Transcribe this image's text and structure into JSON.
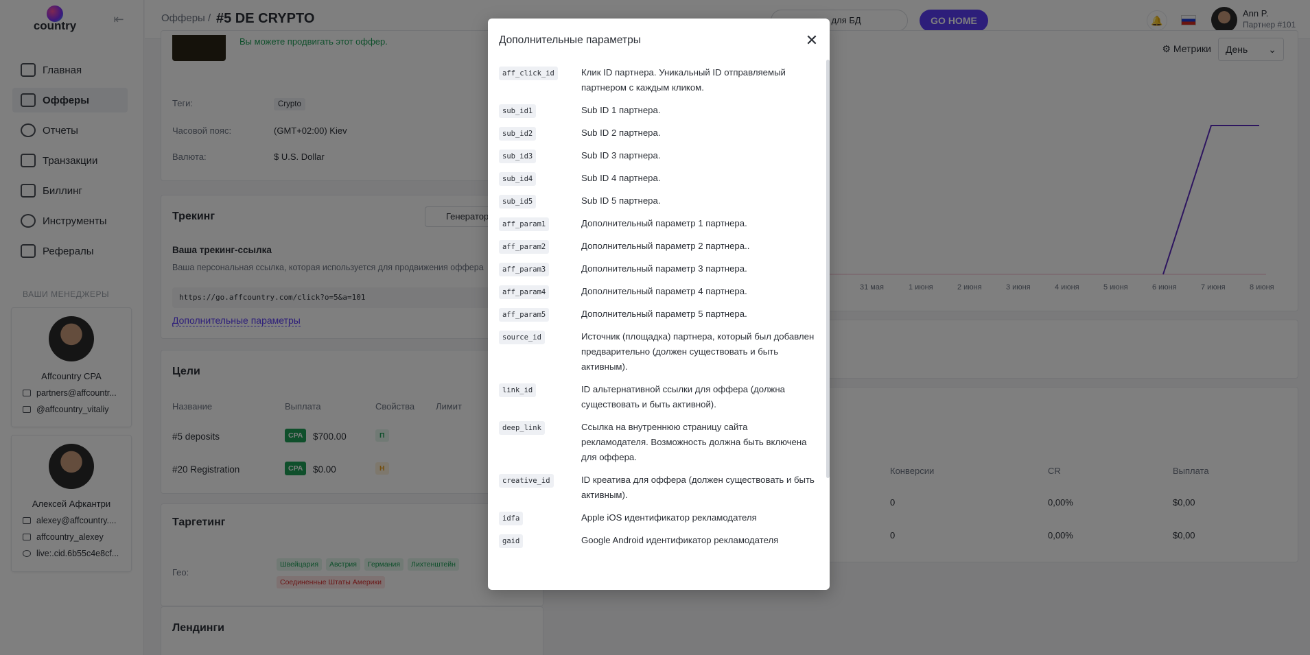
{
  "brand": {
    "logo_text": "country"
  },
  "sidebar": {
    "items": [
      {
        "label": "Главная",
        "icon": "dashboard-icon"
      },
      {
        "label": "Офферы",
        "icon": "offers-icon",
        "active": true
      },
      {
        "label": "Отчеты",
        "icon": "reports-icon"
      },
      {
        "label": "Транзакции",
        "icon": "transactions-icon"
      },
      {
        "label": "Биллинг",
        "icon": "billing-icon"
      },
      {
        "label": "Инструменты",
        "icon": "tools-icon"
      },
      {
        "label": "Рефералы",
        "icon": "referrals-icon"
      }
    ],
    "managers_title": "ВАШИ МЕНЕДЖЕРЫ",
    "managers": [
      {
        "name": "Affcountry CPA",
        "email": "partners@affcountr...",
        "telegram": "@affcountry_vitaliy"
      },
      {
        "name": "Алексей Афкантри",
        "email": "alexey@affcountry....",
        "telegram": "affcountry_alexey",
        "skype": "live:.cid.6b55c4e8cf..."
      }
    ]
  },
  "header": {
    "breadcrumb": "Офферы /",
    "title": "#5 DE CRYPTO",
    "search_text": "резюме для БД",
    "go_home_label": "GO HOME",
    "user_name": "Ann P.",
    "user_role": "Партнер #101"
  },
  "offer": {
    "promo_text": "Вы можете продвигать этот оффер.",
    "tags_label": "Теги:",
    "tags_value": "Crypto",
    "timezone_label": "Часовой пояс:",
    "timezone_value": "(GMT+02:00) Kiev",
    "currency_label": "Валюта:",
    "currency_value": "$ U.S. Dollar"
  },
  "tracking": {
    "title": "Трекинг",
    "generator_label": "Генератор",
    "link_title": "Ваша трекинг-ссылка",
    "link_hint": "Ваша персональная ссылка, которая используется для продвижения оффера",
    "link_value": "https://go.affcountry.com/click?o=5&a=101",
    "extra_params_link": "Дополнительные параметры"
  },
  "goals": {
    "title": "Цели",
    "columns": [
      "Название",
      "Выплата",
      "Свойства",
      "Лимит"
    ],
    "rows": [
      {
        "name": "#5  deposits",
        "type": "CPA",
        "payout": "$700.00",
        "prop": "П"
      },
      {
        "name": "#20  Registration",
        "type": "CPA",
        "payout": "$0.00",
        "prop": "Н"
      }
    ]
  },
  "targeting": {
    "title": "Таргетинг",
    "geo_label": "Гео:",
    "geos_allowed": [
      "Швейцария",
      "Австрия",
      "Германия",
      "Лихтенштейн"
    ],
    "geos_blocked": [
      "Соединенные Штаты Америки"
    ]
  },
  "landings": {
    "title": "Лендинги"
  },
  "chart": {
    "metrics_label": "Метрики",
    "period_label": "День",
    "x_labels": [
      "31 мая",
      "1 июня",
      "2 июня",
      "3 июня",
      "4 июня",
      "5 июня",
      "6 июня",
      "7 июня",
      "8 июня"
    ]
  },
  "stats_table": {
    "columns": [
      "Конверсии",
      "CR",
      "Выплата"
    ],
    "rows": [
      [
        "0",
        "0,00%",
        "$0,00"
      ],
      [
        "0",
        "0,00%",
        "$0,00"
      ]
    ]
  },
  "modal": {
    "title": "Дополнительные параметры",
    "params": [
      {
        "code": "aff_click_id",
        "desc": "Клик ID партнера. Уникальный ID отправляемый партнером с каждым кликом."
      },
      {
        "code": "sub_id1",
        "desc": "Sub ID 1 партнера."
      },
      {
        "code": "sub_id2",
        "desc": "Sub ID 2 партнера."
      },
      {
        "code": "sub_id3",
        "desc": "Sub ID 3 партнера."
      },
      {
        "code": "sub_id4",
        "desc": "Sub ID 4 партнера."
      },
      {
        "code": "sub_id5",
        "desc": "Sub ID 5 партнера."
      },
      {
        "code": "aff_param1",
        "desc": "Дополнительный параметр 1 партнера."
      },
      {
        "code": "aff_param2",
        "desc": "Дополнительный параметр 2 партнера.."
      },
      {
        "code": "aff_param3",
        "desc": "Дополнительный параметр 3 партнера."
      },
      {
        "code": "aff_param4",
        "desc": "Дополнительный параметр 4 партнера."
      },
      {
        "code": "aff_param5",
        "desc": "Дополнительный параметр 5 партнера."
      },
      {
        "code": "source_id",
        "desc": "Источник (площадка) партнера, который был добавлен предварительно (должен существовать и быть активным)."
      },
      {
        "code": "link_id",
        "desc": "ID альтернативной ссылки для оффера (должна существовать и быть активной)."
      },
      {
        "code": "deep_link",
        "desc": "Ссылка на внутреннюю страницу сайта рекламодателя. Возможность должна быть включена для оффера."
      },
      {
        "code": "creative_id",
        "desc": "ID креатива для оффера (должен существовать и быть активным)."
      },
      {
        "code": "idfa",
        "desc": "Apple iOS идентификатор рекламодателя"
      },
      {
        "code": "gaid",
        "desc": "Google Android идентификатор рекламодателя"
      }
    ]
  },
  "colors": {
    "accent": "#5b3df5",
    "success": "#1e9e57",
    "chart_line": "#5b2bbf"
  }
}
